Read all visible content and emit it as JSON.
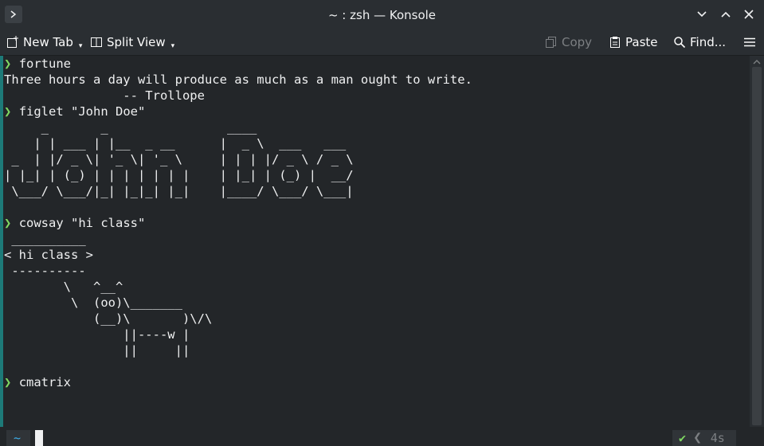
{
  "window": {
    "title": "~ : zsh — Konsole"
  },
  "toolbar": {
    "new_tab": "New Tab",
    "split_view": "Split View",
    "copy": "Copy",
    "paste": "Paste",
    "find": "Find..."
  },
  "terminal": {
    "prompt_symbol": "❯",
    "lines": [
      {
        "type": "cmd",
        "text": "fortune"
      },
      {
        "type": "out",
        "text": "Three hours a day will produce as much as a man ought to write."
      },
      {
        "type": "out",
        "text": "                -- Trollope"
      },
      {
        "type": "cmd",
        "text": "figlet \"John Doe\""
      },
      {
        "type": "out",
        "text": "     _       _                ____"
      },
      {
        "type": "out",
        "text": "    | | ___ | |__  _ __      |  _ \\  ___   ___"
      },
      {
        "type": "out",
        "text": " _  | |/ _ \\| '_ \\| '_ \\     | | | |/ _ \\ / _ \\"
      },
      {
        "type": "out",
        "text": "| |_| | (_) | | | | | | |    | |_| | (_) |  __/"
      },
      {
        "type": "out",
        "text": " \\___/ \\___/|_| |_|_| |_|    |____/ \\___/ \\___|"
      },
      {
        "type": "out",
        "text": ""
      },
      {
        "type": "cmd",
        "text": "cowsay \"hi class\""
      },
      {
        "type": "out",
        "text": " __________"
      },
      {
        "type": "out",
        "text": "< hi class >"
      },
      {
        "type": "out",
        "text": " ----------"
      },
      {
        "type": "out",
        "text": "        \\   ^__^"
      },
      {
        "type": "out",
        "text": "         \\  (oo)\\_______"
      },
      {
        "type": "out",
        "text": "            (__)\\       )\\/\\"
      },
      {
        "type": "out",
        "text": "                ||----w |"
      },
      {
        "type": "out",
        "text": "                ||     ||"
      },
      {
        "type": "out",
        "text": ""
      },
      {
        "type": "cmd",
        "text": "cmatrix"
      }
    ],
    "cwd": "~",
    "last_status_check": "✔",
    "duration": "4s"
  },
  "colors": {
    "accent": "#1d7a78",
    "prompt": "#7fd962",
    "cwd": "#3daee9"
  }
}
